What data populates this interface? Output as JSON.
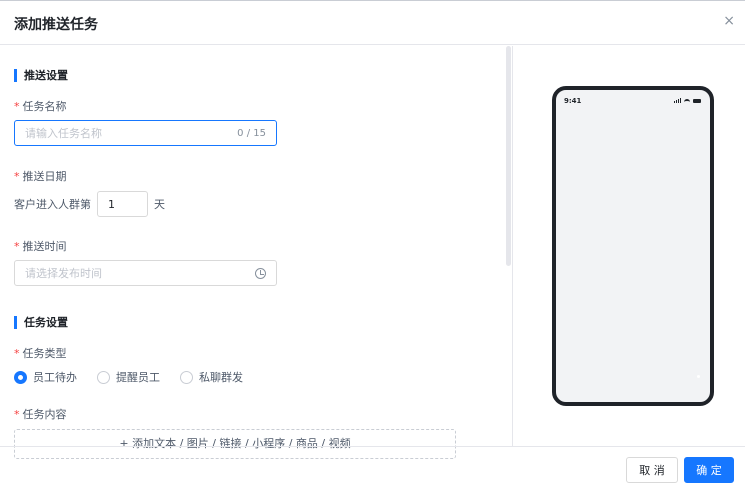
{
  "dialog": {
    "title": "添加推送任务",
    "close_icon": "×"
  },
  "push_settings": {
    "section_title": "推送设置",
    "task_name": {
      "label": "任务名称",
      "placeholder": "请输入任务名称",
      "counter": "0 / 15"
    },
    "push_date": {
      "label": "推送日期",
      "prefix": "客户进入人群第",
      "value": "1",
      "suffix": "天"
    },
    "push_time": {
      "label": "推送时间",
      "placeholder": "请选择发布时间"
    }
  },
  "task_settings": {
    "section_title": "任务设置",
    "task_type": {
      "label": "任务类型",
      "options": [
        "员工待办",
        "提醒员工",
        "私聊群发"
      ],
      "selected": "员工待办"
    },
    "task_content": {
      "label": "任务内容",
      "add_text": "+ 添加文本 / 图片 / 链接 / 小程序 / 商品 / 视频"
    }
  },
  "preview": {
    "status_time": "9:41"
  },
  "footer": {
    "cancel_label": "取 消",
    "ok_label": "确 定"
  },
  "colors": {
    "accent": "#1677ff",
    "required": "#f53f3f"
  }
}
